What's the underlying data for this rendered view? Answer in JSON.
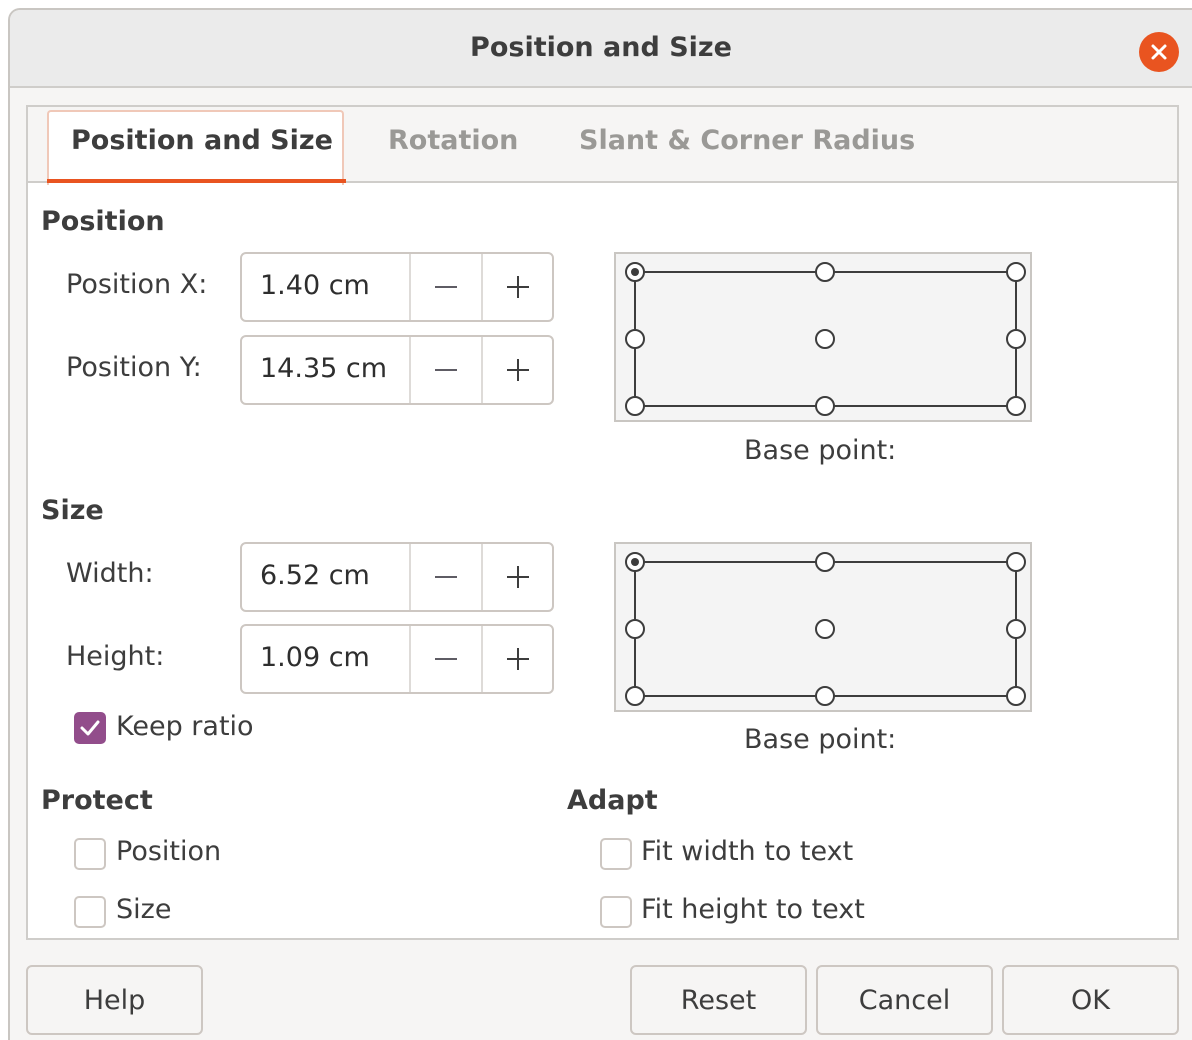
{
  "window": {
    "title": "Position and Size"
  },
  "tabs": [
    {
      "label": "Position and Size",
      "active": true
    },
    {
      "label": "Rotation",
      "active": false
    },
    {
      "label": "Slant & Corner Radius",
      "active": false
    }
  ],
  "position": {
    "heading": "Position",
    "x_label": "Position X:",
    "x_value": "1.40 cm",
    "y_label": "Position Y:",
    "y_value": "14.35 cm",
    "base_point_label": "Base point:",
    "base_point_selected": "top-left"
  },
  "size": {
    "heading": "Size",
    "width_label": "Width:",
    "width_value": "6.52 cm",
    "height_label": "Height:",
    "height_value": "1.09 cm",
    "keep_ratio_label": "Keep ratio",
    "keep_ratio_checked": true,
    "base_point_label": "Base point:",
    "base_point_selected": "top-left"
  },
  "protect": {
    "heading": "Protect",
    "position_label": "Position",
    "position_checked": false,
    "size_label": "Size",
    "size_checked": false
  },
  "adapt": {
    "heading": "Adapt",
    "fit_width_label": "Fit width to text",
    "fit_width_checked": false,
    "fit_height_label": "Fit height to text",
    "fit_height_checked": false
  },
  "buttons": {
    "help": "Help",
    "reset": "Reset",
    "cancel": "Cancel",
    "ok": "OK"
  },
  "colors": {
    "accent": "#e95420",
    "checkbox": "#924d8b"
  }
}
